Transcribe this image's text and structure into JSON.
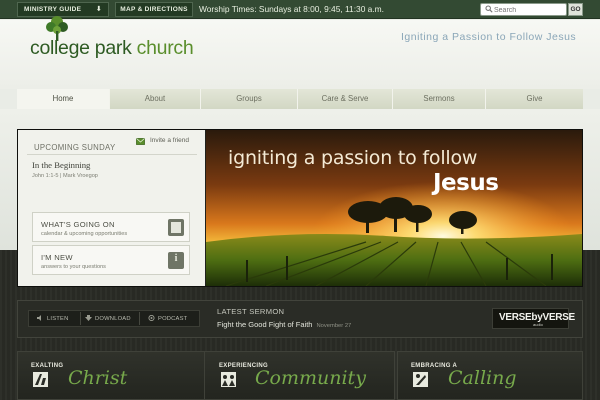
{
  "topbar": {
    "ministry_guide": "MINISTRY GUIDE",
    "map_directions": "MAP & DIRECTIONS",
    "worship_times": "Worship Times: Sundays at 8:00, 9:45, 11:30 a.m.",
    "search_placeholder": "Search",
    "go": "GO"
  },
  "header": {
    "logo_part1": "college park",
    "logo_part2": "church",
    "tagline": "Igniting a Passion to Follow Jesus"
  },
  "nav": {
    "items": [
      {
        "label": "Home",
        "active": true
      },
      {
        "label": "About"
      },
      {
        "label": "Groups"
      },
      {
        "label": "Care & Serve"
      },
      {
        "label": "Sermons"
      },
      {
        "label": "Give"
      }
    ]
  },
  "upcoming": {
    "heading": "UPCOMING SUNDAY",
    "invite": "Invite a friend",
    "title": "In the Beginning",
    "meta": "John 1:1-5 | Mark Vroegop"
  },
  "boxes": {
    "going_title": "WHAT'S GOING ON",
    "going_sub": "calendar & upcoming opportunities",
    "new_title": "I'M NEW",
    "new_sub": "answers to your questions"
  },
  "hero": {
    "line1": "igniting a passion to follow",
    "line2": "Jesus"
  },
  "media": {
    "listen": "LISTEN",
    "download": "DOWNLOAD",
    "podcast": "PODCAST",
    "latest_label": "LATEST SERMON",
    "latest_title": "Fight the Good Fight of Faith",
    "latest_date": "November 27",
    "vbv": "VERSEbyVERSE",
    "vbv_sub": "audio"
  },
  "bottom": {
    "b1_small": "EXALTING",
    "b1_big": "Christ",
    "b2_small": "EXPERIENCING",
    "b2_big": "Community",
    "b3_small": "EMBRACING A",
    "b3_big": "Calling"
  },
  "colors": {
    "brand_green": "#5a8e2c",
    "topbar": "#334a33",
    "tagline": "#8aa6b8"
  }
}
